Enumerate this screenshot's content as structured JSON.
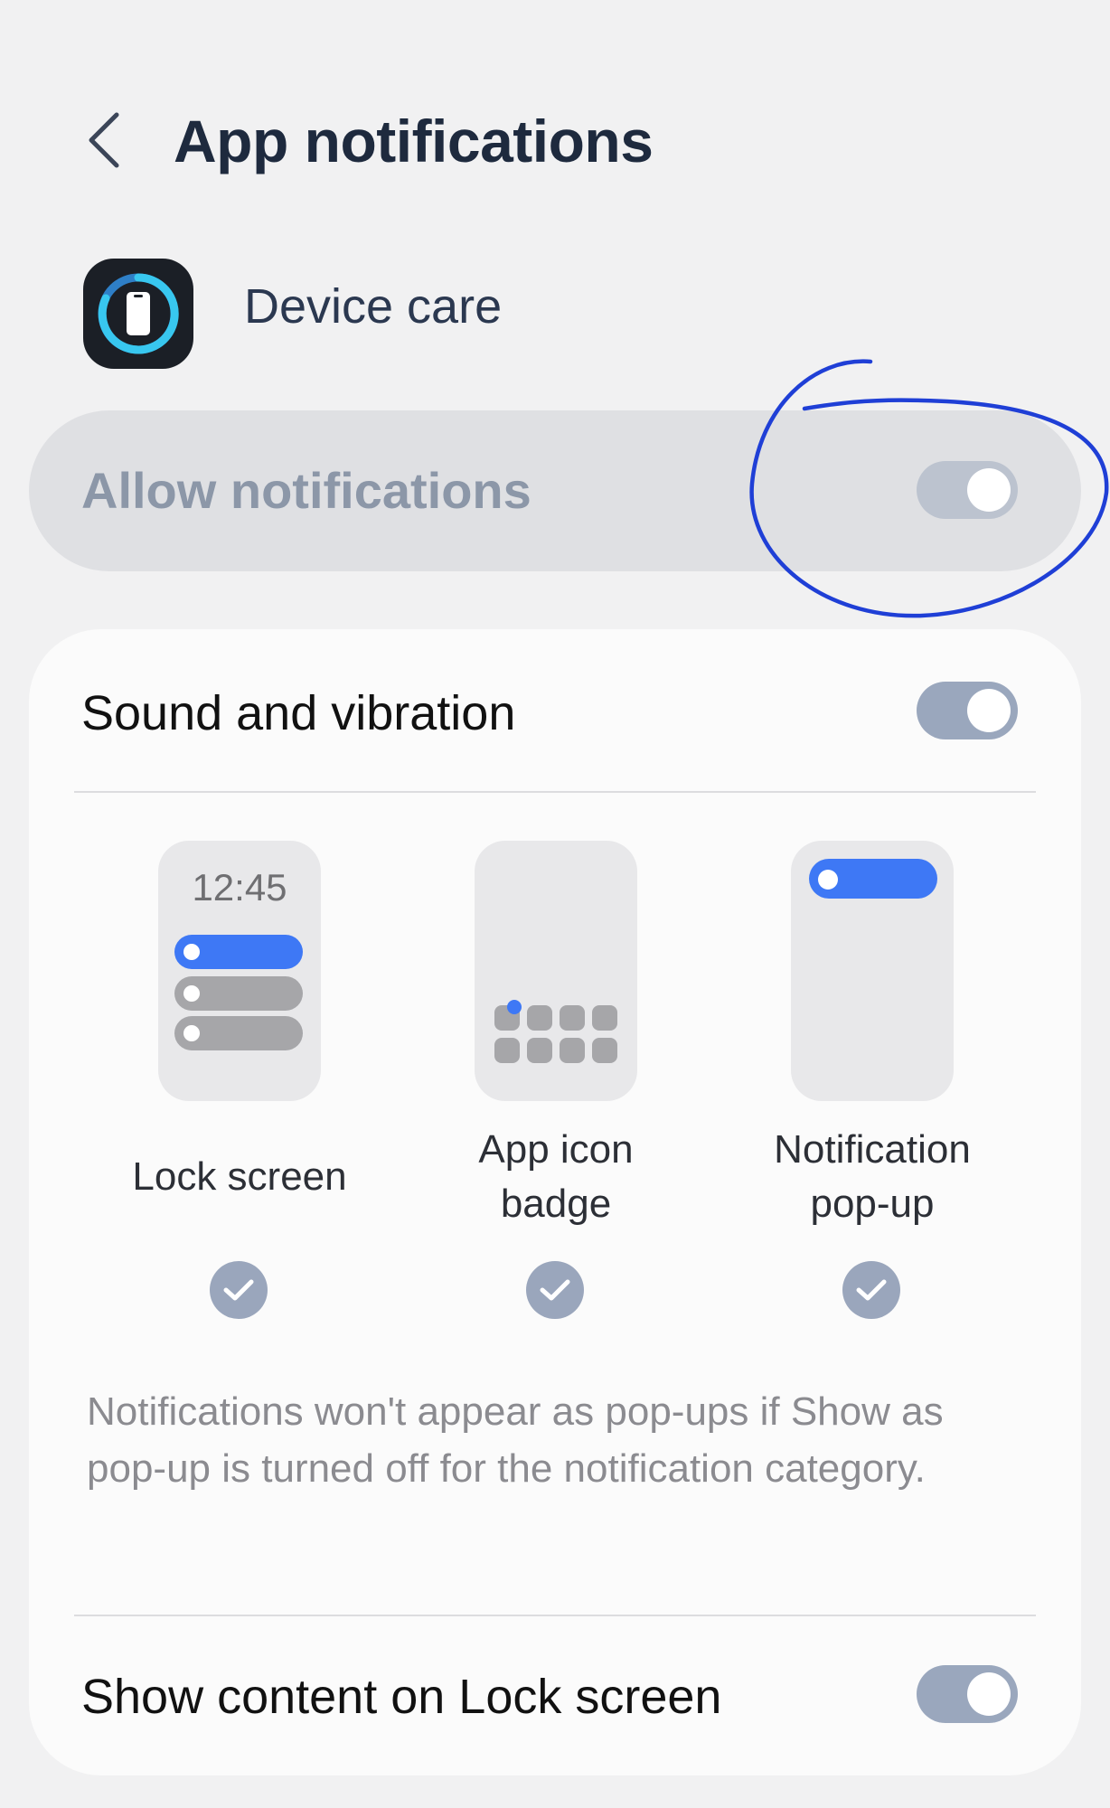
{
  "header": {
    "title": "App notifications",
    "back_icon": "chevron-left-icon"
  },
  "app": {
    "name": "Device care",
    "icon": "device-care-icon"
  },
  "allow": {
    "label": "Allow notifications",
    "enabled": false
  },
  "sound": {
    "label": "Sound and vibration",
    "enabled": true
  },
  "styles": [
    {
      "label": "Lock screen",
      "selected": true,
      "preview_time": "12:45"
    },
    {
      "label_line1": "App icon",
      "label_line2": "badge",
      "selected": true
    },
    {
      "label_line1": "Notification",
      "label_line2": "pop-up",
      "selected": true
    }
  ],
  "note": "Notifications won't appear as pop-ups if Show as pop-up is turned off for the notification category.",
  "lock_content": {
    "label": "Show content on Lock screen",
    "enabled": true
  },
  "colors": {
    "accent": "#3e78f5",
    "toggle_on": "#9aa7bd",
    "toggle_dim": "#bcc3cf",
    "annotation": "#1f3fd6"
  }
}
